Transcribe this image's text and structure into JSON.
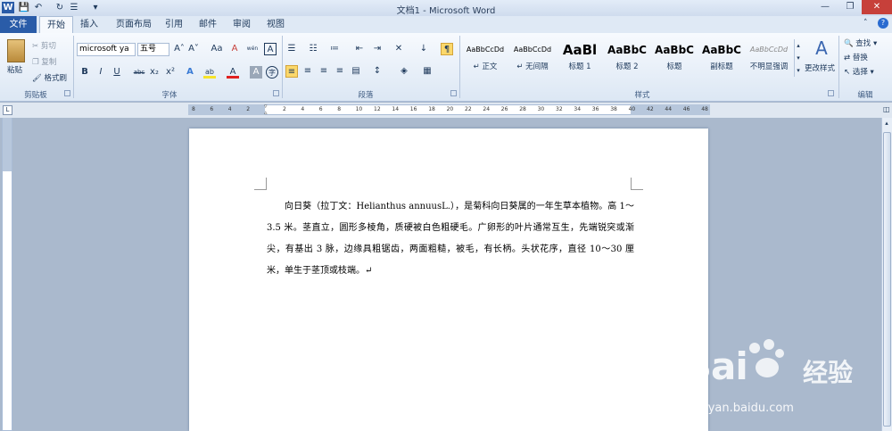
{
  "titlebar": {
    "title": "文档1 - Microsoft Word",
    "qat": [
      "W",
      "💾",
      "↶",
      "↻",
      "☰",
      "▾"
    ],
    "controls": [
      "—",
      "❐",
      "✕"
    ]
  },
  "tabs": {
    "file": "文件",
    "items": [
      "开始",
      "插入",
      "页面布局",
      "引用",
      "邮件",
      "审阅",
      "视图"
    ]
  },
  "clipboard": {
    "paste": "粘贴",
    "cut": "剪切",
    "copy": "复制",
    "format_painter": "格式刷",
    "label": "剪贴板"
  },
  "font": {
    "name": "microsoft ya",
    "size": "五号",
    "grow": "A˄",
    "shrink": "A˅",
    "case": "Aa",
    "clear": "A",
    "phonetic": "wén",
    "border": "A",
    "bold": "B",
    "italic": "I",
    "underline": "U",
    "strike": "abc",
    "sub": "x₂",
    "sup": "x²",
    "effects": "A",
    "highlight": "ab",
    "color": "A",
    "shade": "A",
    "enclosed": "字",
    "label": "字体"
  },
  "paragraph": {
    "label": "段落"
  },
  "styles": {
    "label": "样式",
    "items": [
      {
        "preview": "AaBbCcDd",
        "name": "↵ 正文"
      },
      {
        "preview": "AaBbCcDd",
        "name": "↵ 无间隔"
      },
      {
        "preview": "AaBl",
        "name": "标题 1"
      },
      {
        "preview": "AaBbC",
        "name": "标题 2"
      },
      {
        "preview": "AaBbC",
        "name": "标题"
      },
      {
        "preview": "AaBbC",
        "name": "副标题"
      },
      {
        "preview": "AaBbCcDd",
        "name": "不明显强调"
      }
    ],
    "change": "更改样式"
  },
  "editing": {
    "find": "查找",
    "replace": "替换",
    "select": "选择",
    "label": "编辑"
  },
  "ruler": {
    "ticks": [
      "8",
      "6",
      "4",
      "2",
      "",
      "2",
      "4",
      "6",
      "8",
      "10",
      "12",
      "14",
      "16",
      "18",
      "20",
      "22",
      "24",
      "26",
      "28",
      "30",
      "32",
      "34",
      "36",
      "38",
      "40",
      "42",
      "44",
      "46",
      "48"
    ]
  },
  "document": {
    "text": "向日葵（拉丁文：Helianthus annuusL.），是菊科向日葵属的一年生草本植物。高 1～3.5 米。茎直立，圆形多棱角，质硬被白色粗硬毛。广卵形的叶片通常互生，先端锐突或渐尖，有基出 3 脉，边缘具粗锯齿，两面粗糙，被毛，有长柄。头状花序，直径 10～30 厘米，单生于茎顶或枝端。↵"
  },
  "watermark": {
    "brand": "Bai",
    "brand_cn": "经验",
    "url": "jingyan.baidu.com"
  }
}
